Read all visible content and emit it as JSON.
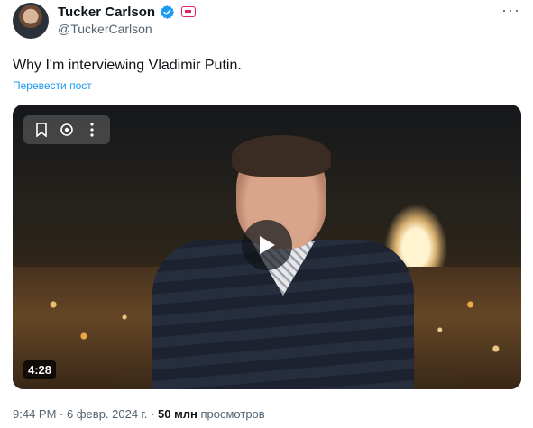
{
  "author": {
    "name": "Tucker Carlson",
    "handle": "@TuckerCarlson",
    "verified_icon": "verified-badge-icon",
    "affiliate_icon": "affiliate-badge-icon"
  },
  "tweet": {
    "text": "Why I'm interviewing Vladimir Putin.",
    "translate_label": "Перевести пост"
  },
  "video": {
    "duration": "4:28",
    "controls": [
      "bookmark-icon",
      "ai-icon",
      "more-icon"
    ],
    "play_icon": "play-icon"
  },
  "meta": {
    "time": "9:44 PM",
    "separator": "·",
    "date": "6 февр. 2024 г.",
    "views_count": "50 млн",
    "views_label": "просмотров"
  },
  "colors": {
    "link": "#1d9bf0",
    "verified": "#1d9bf0",
    "secondary_text": "#536471"
  }
}
